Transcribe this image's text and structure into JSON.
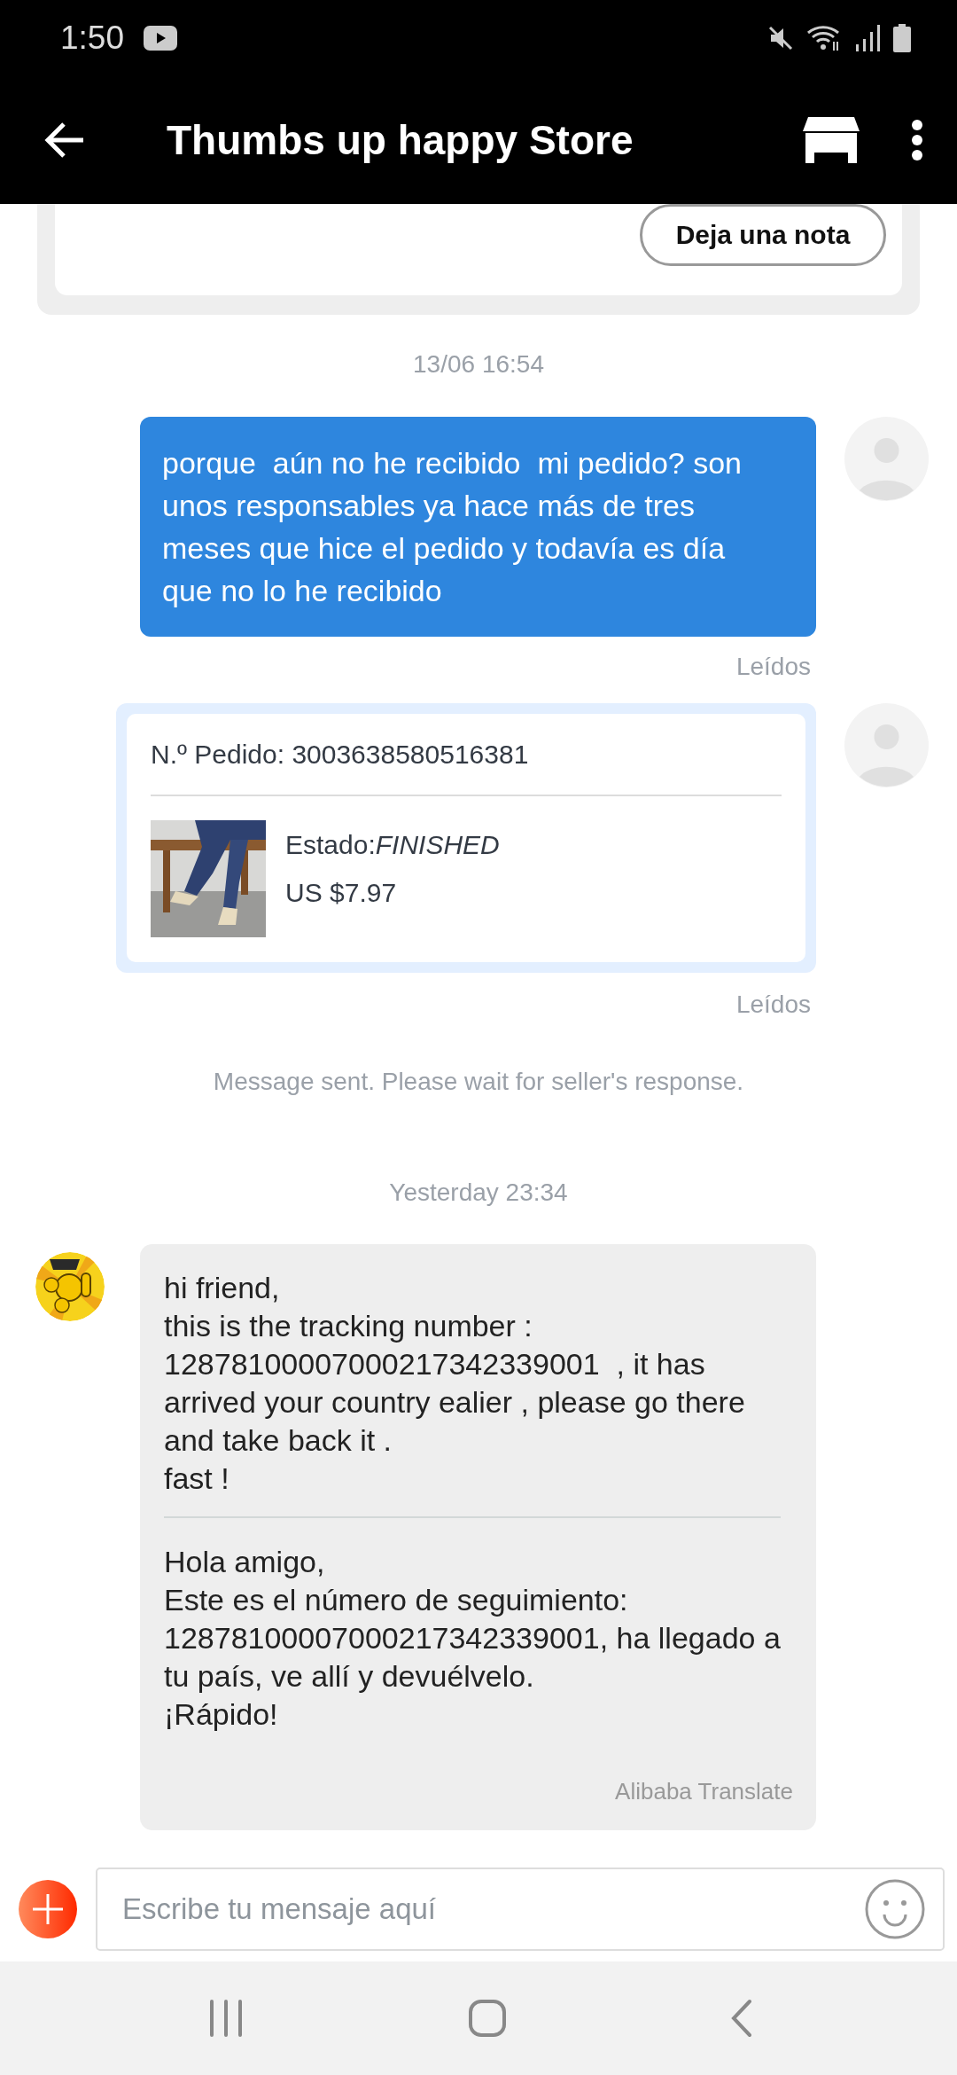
{
  "status_bar": {
    "time": "1:50"
  },
  "header": {
    "title": "Thumbs up happy Store"
  },
  "note_card": {
    "button": "Deja una nota"
  },
  "messages": [
    {
      "kind": "timestamp",
      "text": "13/06 16:54"
    },
    {
      "kind": "text",
      "from_me": true,
      "text": "porque  aún no he recibido  mi pedido? son unos responsables ya hace más de tres meses que hice el pedido y todavía es día que no lo he recibido",
      "receipt": "Leídos"
    },
    {
      "kind": "order",
      "from_me": true,
      "order_label": "N.º Pedido: 3003638580516381",
      "status_label": "Estado:",
      "status": "FINISHED",
      "price": "US $7.97",
      "receipt": "Leídos"
    },
    {
      "kind": "notice",
      "text": "Message sent. Please wait for seller's response."
    },
    {
      "kind": "timestamp",
      "text": "Yesterday 23:34"
    },
    {
      "kind": "translated",
      "from_me": false,
      "text": "hi friend,\nthis is the tracking number :\n12878100007000217342339001  , it has arrived your country ealier , please go there and take back it .\nfast !",
      "translation": "Hola amigo,\nEste es el número de seguimiento:\n12878100007000217342339001, ha llegado a tu país, ve allí y devuélvelo.\n¡Rápido!",
      "credit": "Alibaba Translate"
    }
  ],
  "composer": {
    "placeholder": "Escribe tu mensaje aquí"
  }
}
